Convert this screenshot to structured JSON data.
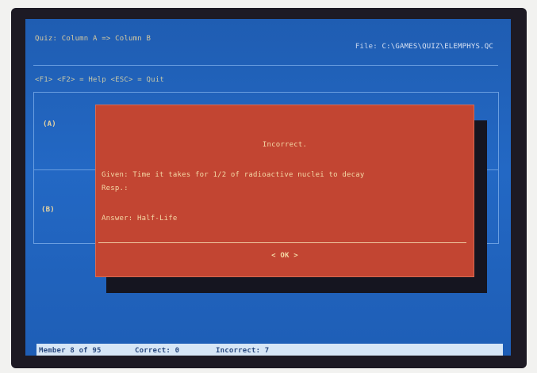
{
  "header": {
    "title": "Quiz: Column A => Column B",
    "file_label": "File:",
    "file_path": "C:\\GAMES\\QUIZ\\ELEMPHYS.QC"
  },
  "help_line": "<F1> <F2> = Help   <ESC> = Quit",
  "panels": {
    "a_label": "(A)",
    "b_label": "(B)"
  },
  "dialog": {
    "title": "Incorrect.",
    "given": "Given:  Time it takes for 1/2 of radioactive nuclei to decay",
    "resp": "Resp.:",
    "answer": "Answer: Half-Life",
    "ok_button": "< OK >"
  },
  "status": {
    "member": "Member 8 of 95",
    "correct": "Correct: 0",
    "incorrect": "Incorrect: 7"
  },
  "colors": {
    "screen_blue": "#2368c4",
    "dialog_red": "#c24532",
    "dialog_text": "#f4d9a6",
    "status_bar": "#d6e6f6"
  }
}
